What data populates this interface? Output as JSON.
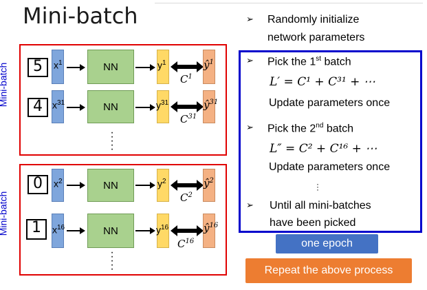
{
  "title": "Mini-batch",
  "left_labels": [
    "Mini-batch",
    "Mini-batch"
  ],
  "rows": [
    {
      "digit": "5",
      "x": "x",
      "x_sup": "1",
      "nn": "NN",
      "y": "y",
      "y_sup": "1",
      "yhat": "ŷ",
      "yhat_sup": "1",
      "c": "C",
      "c_sup": "1"
    },
    {
      "digit": "4",
      "x": "x",
      "x_sup": "31",
      "nn": "NN",
      "y": "y",
      "y_sup": "31",
      "yhat": "ŷ",
      "yhat_sup": "31",
      "c": "C",
      "c_sup": "31"
    },
    {
      "digit": "0",
      "x": "x",
      "x_sup": "2",
      "nn": "NN",
      "y": "y",
      "y_sup": "2",
      "yhat": "ŷ",
      "yhat_sup": "2",
      "c": "C",
      "c_sup": "2"
    },
    {
      "digit": "1",
      "x": "x",
      "x_sup": "16",
      "nn": "NN",
      "y": "y",
      "y_sup": "16",
      "yhat": "ŷ",
      "yhat_sup": "16",
      "c": "C",
      "c_sup": "16"
    }
  ],
  "right": {
    "init_line1": "Randomly initialize",
    "init_line2": "network parameters",
    "pick1": "Pick the 1",
    "pick1_sup": "st",
    "pick1_tail": " batch",
    "formula1": "L′ = C¹ + C³¹ + ⋯",
    "update1": "Update parameters once",
    "pick2": "Pick the 2",
    "pick2_sup": "nd",
    "pick2_tail": " batch",
    "formula2": "L″ = C² + C¹⁶ + ⋯",
    "update2": "Update parameters once",
    "until1": "Until all mini-batches",
    "until2": "have been picked"
  },
  "buttons": {
    "epoch": "one epoch",
    "repeat": "Repeat the above process"
  },
  "colors": {
    "red_box": "#e00000",
    "blue_box": "#0000cc",
    "x_fill": "#7fa6dc",
    "nn_fill": "#a9d18e",
    "y_fill": "#ffd966",
    "yhat_fill": "#f4b183",
    "epoch_btn": "#4472c4",
    "repeat_btn": "#ed7d31"
  }
}
